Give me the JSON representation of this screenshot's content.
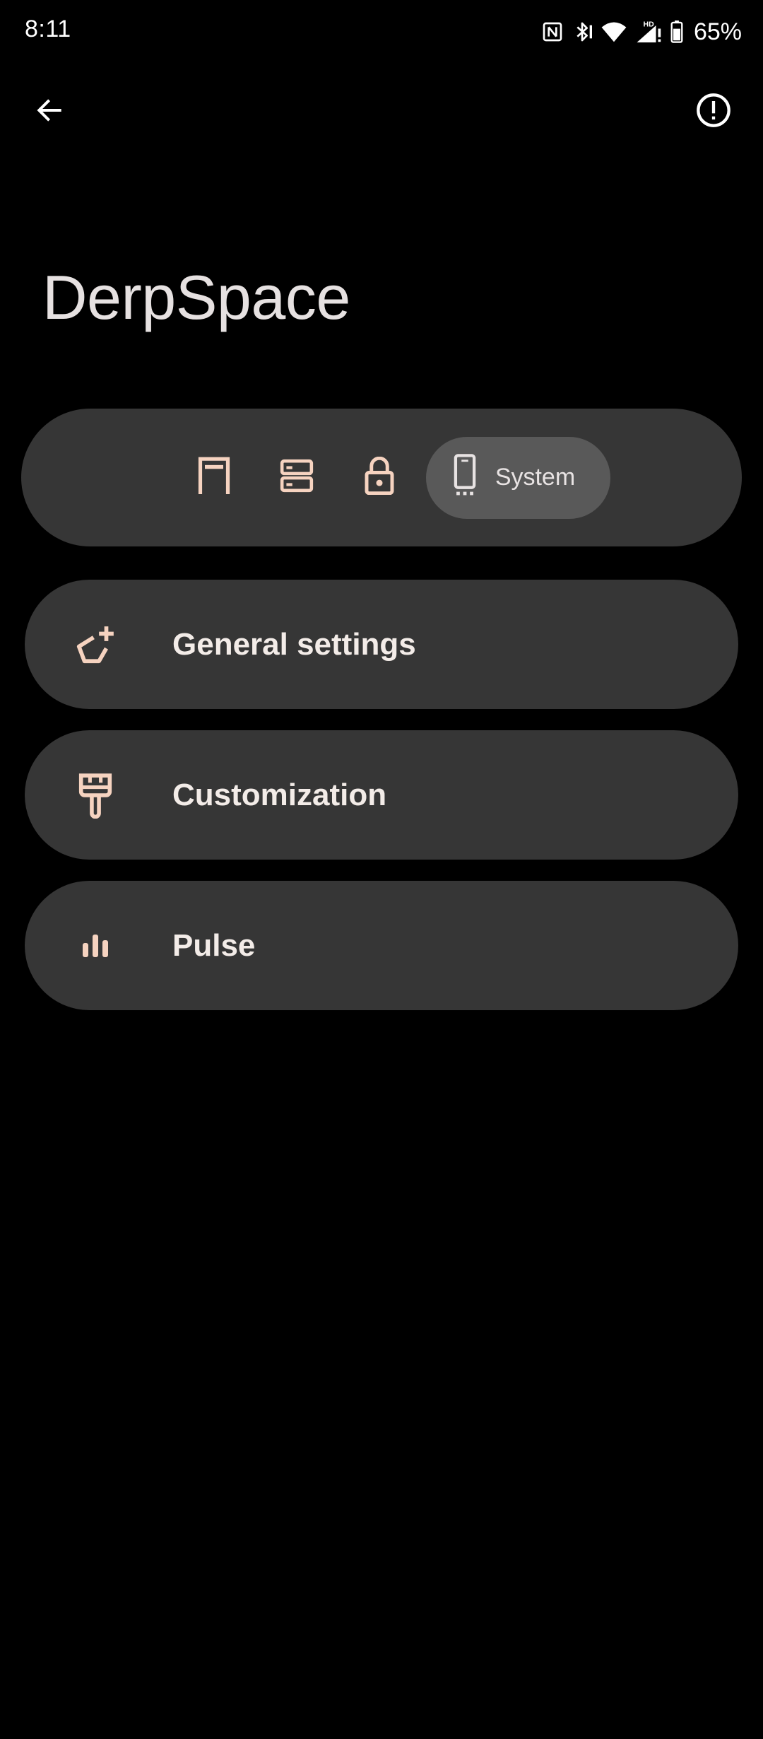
{
  "status_bar": {
    "time": "8:11",
    "battery_percent": "65%",
    "icons": [
      "nfc-icon",
      "bluetooth-icon",
      "wifi-icon",
      "signal-hd-icon",
      "battery-icon"
    ]
  },
  "app_bar": {
    "back_icon": "arrow-back-icon",
    "info_icon": "info-icon"
  },
  "page": {
    "title": "DerpSpace"
  },
  "tabs": [
    {
      "icon": "statusbar-icon",
      "label": "",
      "selected": false
    },
    {
      "icon": "quick-settings-icon",
      "label": "",
      "selected": false
    },
    {
      "icon": "lock-icon",
      "label": "",
      "selected": false
    },
    {
      "icon": "phone-icon",
      "label": "System",
      "selected": true
    }
  ],
  "items": [
    {
      "icon": "settings-plus-icon",
      "label": "General settings"
    },
    {
      "icon": "paint-brush-icon",
      "label": "Customization"
    },
    {
      "icon": "equalizer-icon",
      "label": "Pulse"
    }
  ],
  "colors": {
    "background": "#000000",
    "card": "#363636",
    "selected_tab": "#595959",
    "accent_icon": "#f6d3c0",
    "title_text": "#e6e1e1"
  }
}
